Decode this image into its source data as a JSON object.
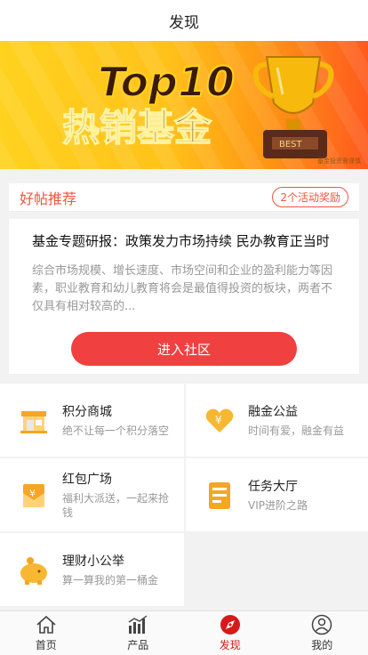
{
  "header": {
    "title": "发现"
  },
  "banner": {
    "logo_text": "Top10",
    "headline": "热销基金",
    "trophy_text": "BEST",
    "credit": "基金投资需谨慎"
  },
  "post": {
    "section_title": "好帖推荐",
    "badge": "2个活动奖励",
    "title": "基金专题研报：政策发力市场持续 民办教育正当时",
    "desc": "综合市场规模、增长速度、市场空间和企业的盈利能力等因素，职业教育和幼儿教育将会是最值得投资的板块，两者不仅具有相对较高的...",
    "cta": "进入社区"
  },
  "features": [
    {
      "icon": "store-icon",
      "title": "积分商城",
      "subtitle": "绝不让每一个积分落空"
    },
    {
      "icon": "heart-coin-icon",
      "title": "融金公益",
      "subtitle": "时间有爱，融金有益"
    },
    {
      "icon": "red-envelope-icon",
      "title": "红包广场",
      "subtitle": "福利大派送，一起来抢钱"
    },
    {
      "icon": "task-board-icon",
      "title": "任务大厅",
      "subtitle": "VIP进阶之路"
    },
    {
      "icon": "piggy-bank-icon",
      "title": "理财小公举",
      "subtitle": "算一算我的第一桶金"
    }
  ],
  "tabs": [
    {
      "label": "首页",
      "icon": "home-icon"
    },
    {
      "label": "产品",
      "icon": "chart-icon"
    },
    {
      "label": "发现",
      "icon": "discover-icon",
      "active": true
    },
    {
      "label": "我的",
      "icon": "user-icon"
    }
  ],
  "colors": {
    "accent": "#f04040",
    "tab_active": "#d61a1a",
    "badge": "#f2553f"
  }
}
